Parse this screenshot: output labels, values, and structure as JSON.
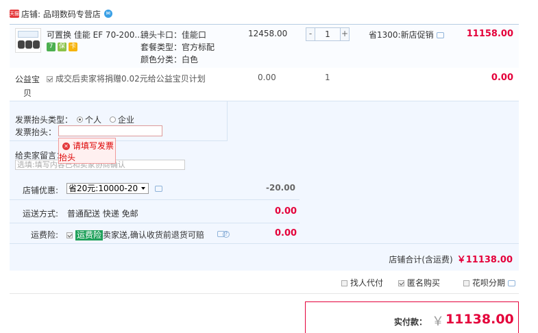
{
  "shop": {
    "badge": "天猫",
    "label": "店铺: 品翊数码专营店",
    "chat_icon": "wangwang-icon"
  },
  "item": {
    "title": "可置换 佳能 EF 70-200...",
    "specs": [
      "镜头卡口：佳能口",
      "套餐类型：官方标配",
      "颜色分类：白色"
    ],
    "price": "12458.00",
    "quantity": "1",
    "qty_minus": "-",
    "qty_plus": "+",
    "promo": "省1300:新店促销",
    "total": "11158.00",
    "service_icons": [
      "7-day-return-icon",
      "guarantee-icon",
      "credit-card-icon"
    ],
    "icon_glyphs": [
      "7",
      "保",
      "卡"
    ]
  },
  "charity": {
    "label": "公益宝贝",
    "text": "成交后卖家将捐赠0.02元给公益宝贝计划",
    "price": "0.00",
    "qty": "1",
    "total": "0.00"
  },
  "invoice": {
    "type_label": "发票抬头类型：",
    "option_personal": "个人",
    "option_company": "企业",
    "head_label": "发票抬头：",
    "head_value": "",
    "error": "请填写发票抬头"
  },
  "message": {
    "label": "给卖家留言：",
    "placeholder": "选填:填写内容已和卖家协商确认"
  },
  "coupon": {
    "label": "店铺优惠:",
    "selected": "省20元:10000-20",
    "value": "-20.00"
  },
  "shipping": {
    "label": "运送方式:",
    "text": "普通配送 快递 免邮",
    "value": "0.00"
  },
  "insurance": {
    "label": "运费险:",
    "tag": "运费险",
    "text": "卖家送,确认收货前退货可赔",
    "value": "0.00"
  },
  "summary": {
    "label": "店铺合计(含运费)",
    "amount": "￥11138.00"
  },
  "options": {
    "proxy": "找人代付",
    "anonymous": "匿名购买",
    "huabei": "花呗分期"
  },
  "pay": {
    "label": "实付款：",
    "currency": "￥",
    "amount": "11138.00"
  }
}
